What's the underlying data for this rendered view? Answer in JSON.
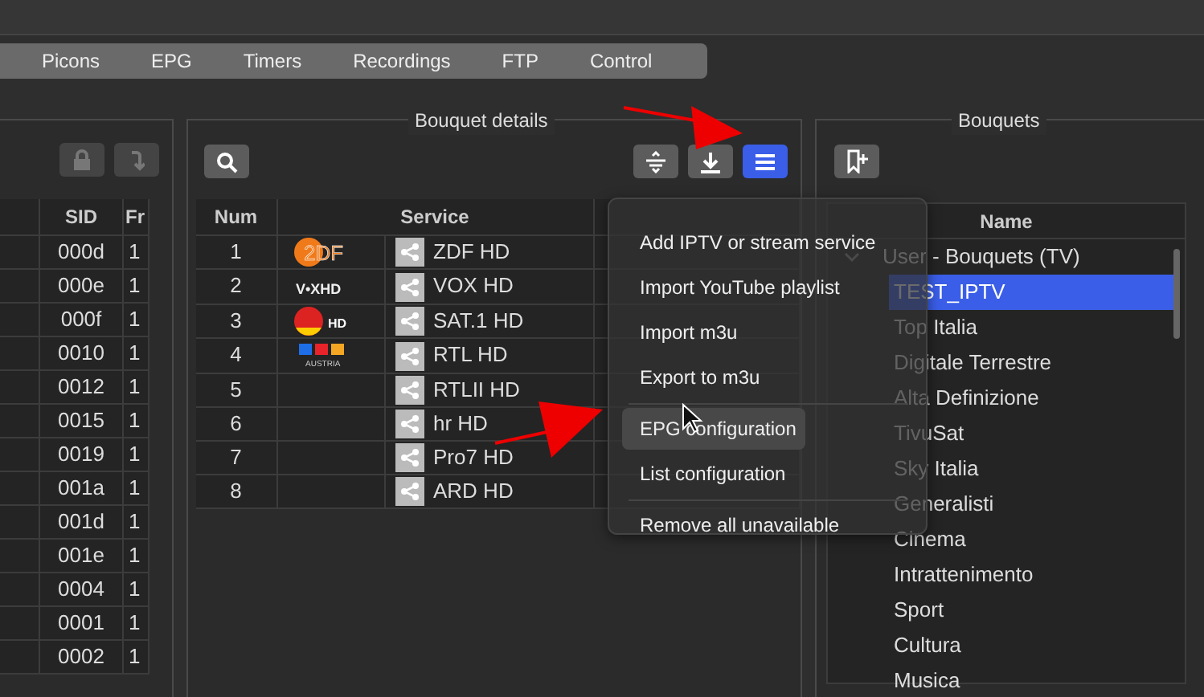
{
  "tabs": [
    {
      "label": "Picons",
      "selected": false
    },
    {
      "label": "EPG",
      "selected": false
    },
    {
      "label": "Timers",
      "selected": false
    },
    {
      "label": "Recordings",
      "selected": false
    },
    {
      "label": "FTP",
      "selected": false
    },
    {
      "label": "Control",
      "selected": false
    }
  ],
  "services_panel": {
    "columns": [
      "SID",
      "Fr"
    ],
    "rows": [
      {
        "sid": "000d",
        "col": "1"
      },
      {
        "sid": "000e",
        "col": "1"
      },
      {
        "sid": "000f",
        "col": "1"
      },
      {
        "sid": "0010",
        "col": "1"
      },
      {
        "sid": "0012",
        "col": "1"
      },
      {
        "sid": "0015",
        "col": "1"
      },
      {
        "sid": "0019",
        "col": "1"
      },
      {
        "sid": "001a",
        "col": "1"
      },
      {
        "sid": "001d",
        "col": "1"
      },
      {
        "sid": "001e",
        "col": "1"
      },
      {
        "sid": "0004",
        "col": "1"
      },
      {
        "sid": "0001",
        "col": "1"
      },
      {
        "sid": "0002",
        "col": "1"
      }
    ]
  },
  "bouquet_details": {
    "title": "Bouquet details",
    "columns": [
      "Num",
      "Service"
    ],
    "rows": [
      {
        "num": "1",
        "picon": {
          "kind": "disc",
          "text": "2DF"
        },
        "service": "ZDF HD"
      },
      {
        "num": "2",
        "picon": {
          "kind": "wordmark",
          "text": "V•XHD"
        },
        "service": "VOX HD"
      },
      {
        "num": "3",
        "picon": {
          "kind": "ball",
          "text": "HD"
        },
        "service": "SAT.1 HD"
      },
      {
        "num": "4",
        "picon": {
          "kind": "squares",
          "text": "AUSTRIA"
        },
        "service": "RTL HD"
      },
      {
        "num": "5",
        "service": "RTLII HD"
      },
      {
        "num": "6",
        "service": "hr HD"
      },
      {
        "num": "7",
        "service": "Pro7 HD"
      },
      {
        "num": "8",
        "service": "ARD HD"
      }
    ]
  },
  "menu": {
    "items": [
      {
        "label": "Add IPTV or stream service",
        "hover": false,
        "separator_before": false
      },
      {
        "label": "Import YouTube playlist",
        "hover": false,
        "separator_before": false
      },
      {
        "label": "Import m3u",
        "hover": false,
        "separator_before": false
      },
      {
        "label": "Export to m3u",
        "hover": false,
        "separator_before": false
      },
      {
        "label": "EPG configuration",
        "hover": true,
        "separator_before": true
      },
      {
        "label": "List configuration",
        "hover": false,
        "separator_before": false
      },
      {
        "label": "Remove all unavailable",
        "hover": false,
        "separator_before": true
      }
    ]
  },
  "bouquets": {
    "title": "Bouquets",
    "column": "Name",
    "tree": [
      {
        "label": "User - Bouquets (TV)",
        "expanded": true,
        "selected": false,
        "children": [
          {
            "label": "TEST_IPTV",
            "selected": true
          },
          {
            "label": "Top Italia",
            "selected": false
          },
          {
            "label": "Digitale Terrestre",
            "selected": false
          },
          {
            "label": "Alta Definizione",
            "selected": false
          },
          {
            "label": "TivuSat",
            "selected": false
          },
          {
            "label": "Sky Italia",
            "selected": false
          },
          {
            "label": "Generalisti",
            "selected": false
          },
          {
            "label": "Cinema",
            "selected": false
          },
          {
            "label": "Intrattenimento",
            "selected": false
          },
          {
            "label": "Sport",
            "selected": false
          },
          {
            "label": "Cultura",
            "selected": false
          },
          {
            "label": "Musica",
            "selected": false
          }
        ]
      }
    ]
  }
}
